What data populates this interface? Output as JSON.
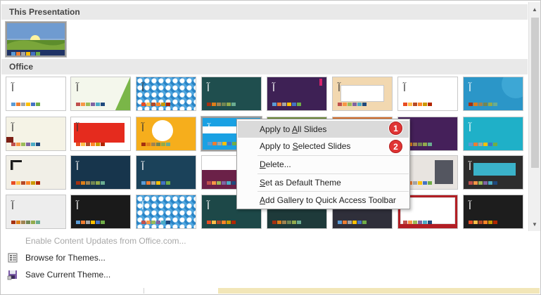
{
  "sections": {
    "this_presentation": "This Presentation",
    "office": "Office"
  },
  "context_menu": {
    "items": [
      {
        "label": "Apply to All Slides",
        "accel": "A"
      },
      {
        "label": "Apply to Selected Slides",
        "accel": "S"
      },
      {
        "label": "Delete...",
        "accel": "D"
      },
      {
        "label": "Set as Default Theme",
        "accel": "S"
      },
      {
        "label": "Add Gallery to Quick Access Toolbar",
        "accel": "A"
      }
    ],
    "badges": [
      "1",
      "2"
    ]
  },
  "footer": {
    "enable_updates": "Enable Content Updates from Office.com...",
    "browse_themes": "Browse for Themes...",
    "save_theme": "Save Current Theme..."
  },
  "thumb_glyph": "آ",
  "thumb_glyph_alt": "آآ",
  "icons": {
    "scroll_up": "scroll-up-icon",
    "scroll_down": "scroll-down-icon",
    "browse": "folder-list-icon",
    "save": "save-theme-icon"
  }
}
